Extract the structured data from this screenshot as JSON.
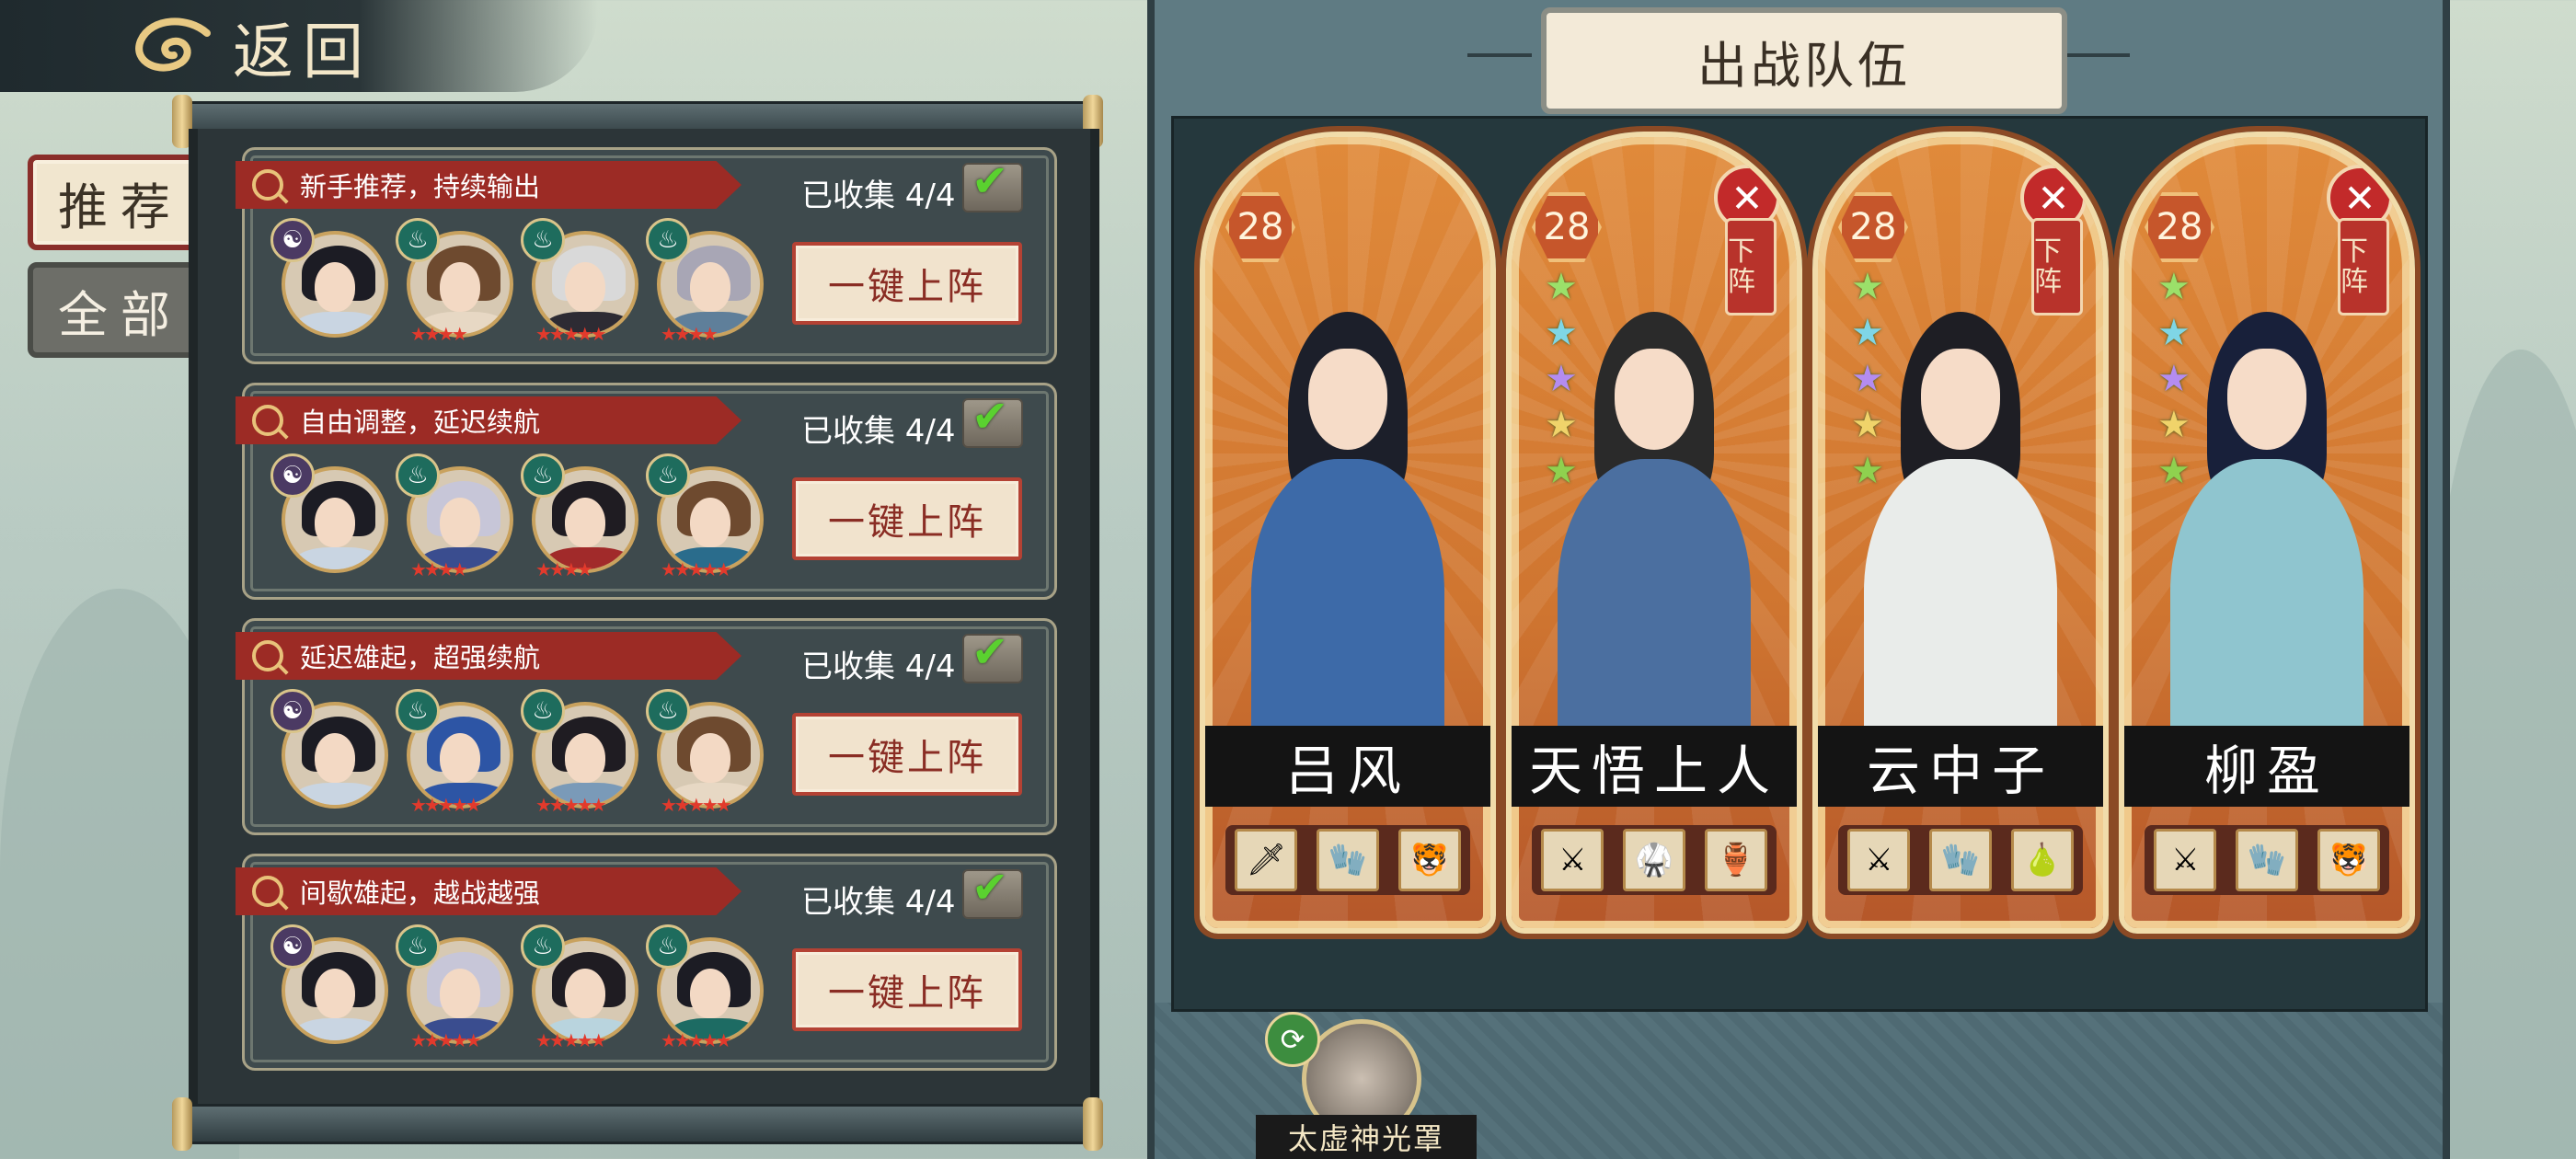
{
  "back": {
    "label": "返回",
    "icon": "cloud-swirl-icon"
  },
  "tabs": [
    {
      "label": "推荐",
      "active": true
    },
    {
      "label": "全部",
      "active": false
    }
  ],
  "teams": [
    {
      "title": "新手推荐，持续输出",
      "collected": "已收集 4/4",
      "button": "一键上阵",
      "heroes": [
        {
          "element": "yin",
          "stars": "",
          "hair": "#1c1c24",
          "body": "#c9d5e2"
        },
        {
          "element": "wood",
          "stars": "★★★★",
          "hair": "#6e4a2f",
          "body": "#e7d8c4"
        },
        {
          "element": "wood",
          "stars": "★★★★★",
          "hair": "#d9d9d9",
          "body": "#2d2b33"
        },
        {
          "element": "wood",
          "stars": "★★★★",
          "hair": "#a8a6b5",
          "body": "#5f7f9a"
        }
      ]
    },
    {
      "title": "自由调整，延迟续航",
      "collected": "已收集 4/4",
      "button": "一键上阵",
      "heroes": [
        {
          "element": "yin",
          "stars": "",
          "hair": "#1c1c24",
          "body": "#c9d5e2"
        },
        {
          "element": "wood",
          "stars": "★★★★",
          "hair": "#c7c6d8",
          "body": "#3a4d8f"
        },
        {
          "element": "wood",
          "stars": "★★★★",
          "hair": "#1f1c22",
          "body": "#a12a2a"
        },
        {
          "element": "wood",
          "stars": "★★★★★",
          "hair": "#6e4a2f",
          "body": "#2a6c8c"
        }
      ]
    },
    {
      "title": "延迟雄起，超强续航",
      "collected": "已收集 4/4",
      "button": "一键上阵",
      "heroes": [
        {
          "element": "yin",
          "stars": "",
          "hair": "#1c1c24",
          "body": "#c9d5e2"
        },
        {
          "element": "wood",
          "stars": "★★★★★",
          "hair": "#2d55a5",
          "body": "#2d55a5"
        },
        {
          "element": "wood",
          "stars": "★★★★★",
          "hair": "#1f1c22",
          "body": "#7a9ab8"
        },
        {
          "element": "wood",
          "stars": "★★★★★",
          "hair": "#6e4a2f",
          "body": "#e7d8c4"
        }
      ]
    },
    {
      "title": "间歇雄起，越战越强",
      "collected": "已收集 4/4",
      "button": "一键上阵",
      "heroes": [
        {
          "element": "yin",
          "stars": "",
          "hair": "#1c1c24",
          "body": "#c9d5e2"
        },
        {
          "element": "wood",
          "stars": "★★★★★",
          "hair": "#c7c6d8",
          "body": "#3a4d8f"
        },
        {
          "element": "wood",
          "stars": "★★★★★",
          "hair": "#1f1c22",
          "body": "#b9d4de"
        },
        {
          "element": "wood",
          "stars": "★★★★★",
          "hair": "#1c1c24",
          "body": "#1d6b63"
        }
      ]
    }
  ],
  "battle": {
    "title": "出战队伍",
    "heroes": [
      {
        "name": "吕风",
        "level": "28",
        "removable": false,
        "stars": "",
        "hair": "#1c1f2a",
        "robe": "#3d6aa8",
        "equip": [
          "sword-icon",
          "gauntlet-icon",
          "tiger-icon"
        ]
      },
      {
        "name": "天悟上人",
        "level": "28",
        "removable": true,
        "stars": "★★★★★",
        "hair": "#2a2a2a",
        "robe": "#4b6fa0",
        "equip": [
          "blade-icon",
          "armor-icon",
          "vase-icon"
        ]
      },
      {
        "name": "云中子",
        "level": "28",
        "removable": true,
        "stars": "★★★★★",
        "hair": "#1e1e24",
        "robe": "#e9ecea",
        "equip": [
          "blade-icon",
          "gauntlet-icon",
          "gourd-icon"
        ]
      },
      {
        "name": "柳盈",
        "level": "28",
        "removable": true,
        "stars": "★★★★★",
        "hair": "#18203a",
        "robe": "#8fc5cf",
        "equip": [
          "blade-icon",
          "gauntlet-icon",
          "tiger-icon"
        ]
      }
    ],
    "remove_label": "下阵",
    "artifact": {
      "name": "太虚神光罩",
      "badge_icon": "refresh-icon"
    }
  },
  "colors": {
    "accent_red": "#9c2b25",
    "star_rainbow": "#8fd14f",
    "panel": "#3e4a4d"
  }
}
